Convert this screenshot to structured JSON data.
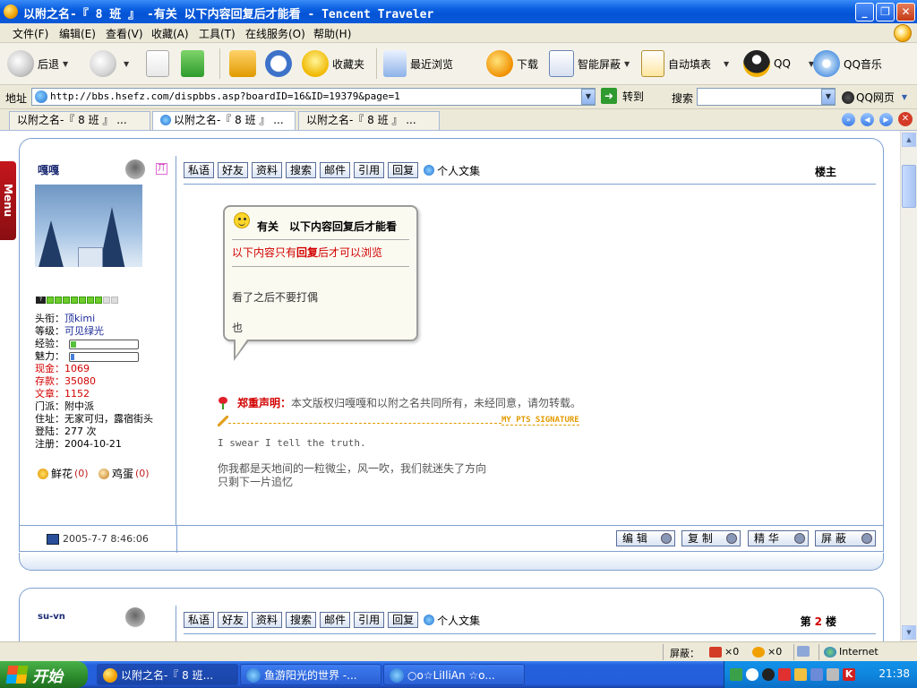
{
  "window": {
    "title": "以附之名-『 8 班 』 -有关 以下内容回复后才能看 - Tencent Traveler"
  },
  "menubar": {
    "items": [
      "文件(F)",
      "编辑(E)",
      "查看(V)",
      "收藏(A)",
      "工具(T)",
      "在线服务(O)",
      "帮助(H)"
    ]
  },
  "toolbar": {
    "back": "后退",
    "favorites": "收藏夹",
    "recent": "最近浏览",
    "download": "下载",
    "block": "智能屏蔽",
    "autofill": "自动填表",
    "qq": "QQ",
    "qqmusic": "QQ音乐"
  },
  "addressbar": {
    "label": "地址",
    "url": "http://bbs.hsefz.com/dispbbs.asp?boardID=16&ID=19379&page=1",
    "go": "转到",
    "search_label": "搜索",
    "qq_web": "QQ网页"
  },
  "tabs": [
    {
      "label": "以附之名-『 8 班 』 ..."
    },
    {
      "label": "以附之名-『 8 班 』 ..."
    },
    {
      "label": "以附之名-『 8 班 』 ..."
    }
  ],
  "sidebar_menu": "Menu",
  "post1": {
    "username": "嘎嘎",
    "gender_mark": "丌",
    "title": "顶kimi",
    "level": "可见绿光",
    "exp_fill": 0.08,
    "charm_fill": 0.05,
    "cash": "1069",
    "deposit": "35080",
    "articles": "1152",
    "sect": "附中派",
    "address": "无家可归，露宿街头",
    "logins": "277 次",
    "registered": "2004-10-21",
    "labels": {
      "title": "头衔：",
      "level": "等级：",
      "exp": "经验：",
      "charm": "魅力：",
      "cash": "现金：",
      "deposit": "存款：",
      "articles": "文章：",
      "sect": "门派：",
      "address": "住址：",
      "logins": "登陆：",
      "registered": "注册："
    },
    "flowers_label": "鲜花",
    "flowers": "(0)",
    "eggs_label": "鸡蛋",
    "eggs": "(0)",
    "actions": [
      "私语",
      "好友",
      "资料",
      "搜索",
      "邮件",
      "引用",
      "回复"
    ],
    "blog": "个人文集",
    "floor": "楼主",
    "bubble_title": "有关　以下内容回复后才能看",
    "bubble_note_pre": "以下内容只有",
    "bubble_note_bold": "回复",
    "bubble_note_post": "后才可以浏览",
    "bubble_line1": "看了之后不要打偶",
    "bubble_line2": "也",
    "decl_label": "郑重声明：",
    "decl_text": "本文版权归嘎嘎和以附之名共同所有，未经同意，请勿转载。",
    "sig_tag": "MY PTS SIGNATURE",
    "swear": "I swear I tell the truth.",
    "sig_line1": "你我都是天地间的一粒微尘，风一吹，我们就迷失了方向",
    "sig_line2": "只剩下一片追忆",
    "timestamp": "2005-7-7 8:46:06",
    "ops": [
      "编 辑",
      "复 制",
      "精 华",
      "屏 蔽"
    ]
  },
  "post2": {
    "username": "su-vn",
    "actions": [
      "私语",
      "好友",
      "资料",
      "搜索",
      "邮件",
      "引用",
      "回复"
    ],
    "blog": "个人文集",
    "floor_pre": "第",
    "floor_num": "2",
    "floor_post": "楼"
  },
  "statusbar": {
    "block_label": "屏蔽：",
    "popups": "×0",
    "ads": "×0",
    "zone": "Internet"
  },
  "taskbar": {
    "start": "开始",
    "tasks": [
      {
        "label": "以附之名-『 8 班..."
      },
      {
        "label": "鱼游阳光的世界 -..."
      },
      {
        "label": "○o☆LiIliAn ☆o..."
      }
    ],
    "clock": "21:38"
  }
}
